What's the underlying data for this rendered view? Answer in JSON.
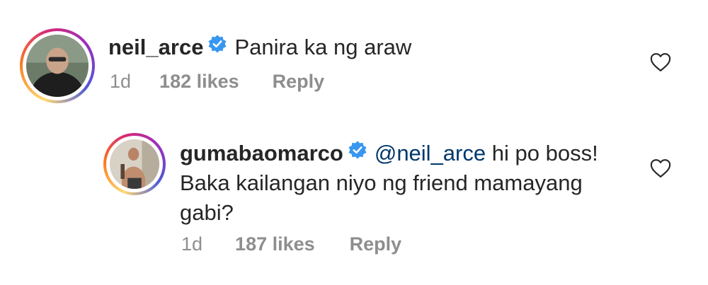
{
  "comments": [
    {
      "username": "neil_arce",
      "verified": true,
      "text": "Panira ka ng araw",
      "time": "1d",
      "likes": "182 likes",
      "reply_label": "Reply"
    },
    {
      "username": "gumabaomarco",
      "verified": true,
      "mention": "@neil_arce",
      "text_line1": "hi po boss!",
      "text_line2": "Baka kailangan niyo ng friend mamayang",
      "text_line3": "gabi?",
      "time": "1d",
      "likes": "187 likes",
      "reply_label": "Reply"
    }
  ],
  "icons": {
    "verified": "verified-badge-icon",
    "like": "heart-outline-icon"
  },
  "colors": {
    "verified_blue": "#3897f0",
    "meta_gray": "#8e8e8e",
    "text": "#262626",
    "mention": "#00376b"
  }
}
